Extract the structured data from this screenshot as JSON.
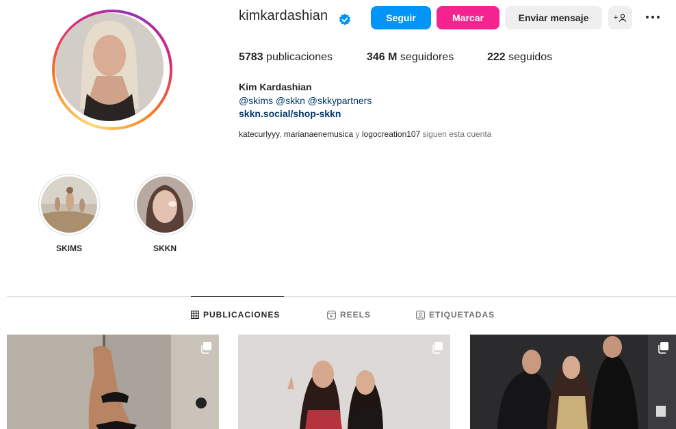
{
  "profile": {
    "username": "kimkardashian",
    "full_name": "Kim Kardashian",
    "bio_tags": "@skims @skkn @skkypartners",
    "bio_link": "skkn.social/shop-skkn",
    "verified_icon": "verified-badge-icon"
  },
  "actions": {
    "follow": "Seguir",
    "mark": "Marcar",
    "message": "Enviar mensaje",
    "suggest": "+",
    "suggest_icon": "add-person-icon",
    "more_icon": "more-options-icon"
  },
  "stats": {
    "posts_count": "5783",
    "posts_label": "publicaciones",
    "followers_count": "346 M",
    "followers_label": "seguidores",
    "following_count": "222",
    "following_label": "seguidos"
  },
  "followed_by": {
    "users": [
      "katecurlyyy",
      "marianaenemusica",
      "logocreation107"
    ],
    "sep1": ", ",
    "sep2": " y ",
    "suffix": " siguen esta cuenta"
  },
  "highlights": [
    {
      "label": "SKIMS"
    },
    {
      "label": "SKKN"
    }
  ],
  "tabs": [
    {
      "label": "PUBLICACIONES",
      "icon": "grid-icon",
      "active": true
    },
    {
      "label": "REELS",
      "icon": "reels-icon",
      "active": false
    },
    {
      "label": "ETIQUETADAS",
      "icon": "tagged-icon",
      "active": false
    }
  ],
  "colors": {
    "follow": "#0095f6",
    "mark": "#f4238f",
    "link": "#00376b",
    "verified": "#0095f6"
  }
}
